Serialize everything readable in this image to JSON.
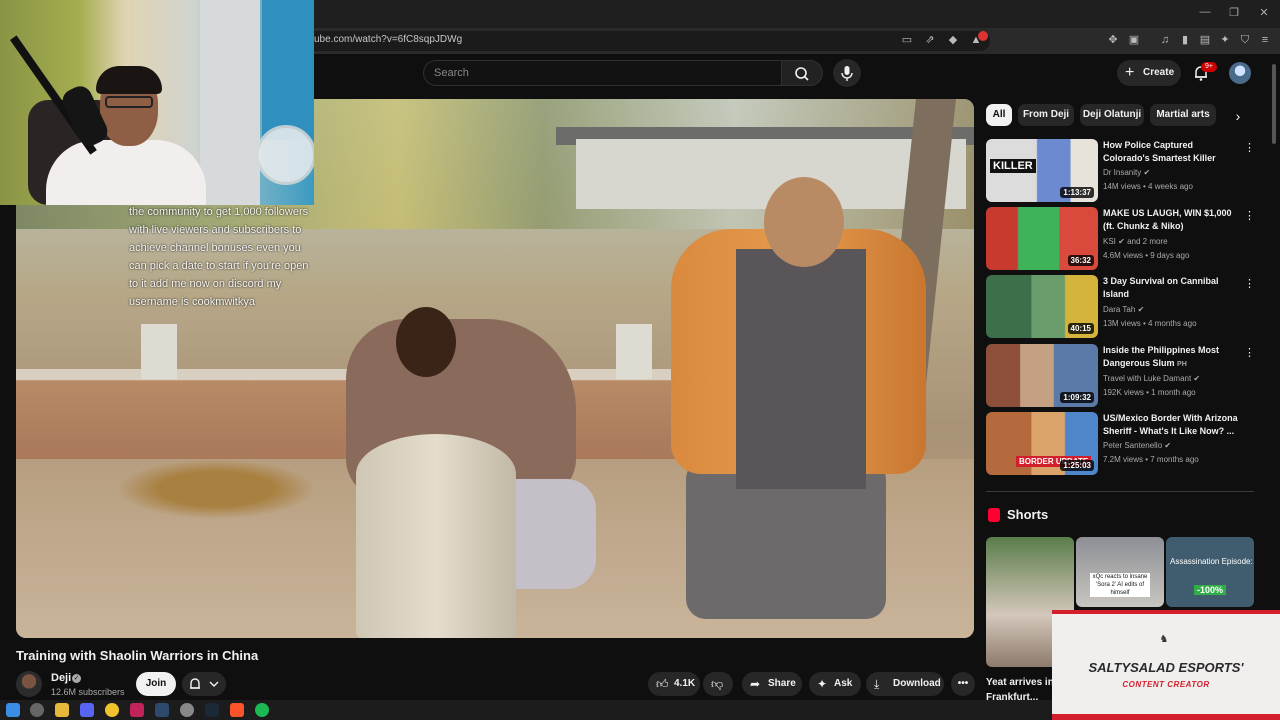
{
  "browser": {
    "url": "ube.com/watch?v=6fC8sqpJDWg",
    "notification_badge": "9+"
  },
  "masthead": {
    "search_placeholder": "Search",
    "create_label": "Create",
    "bell_badge": "9+"
  },
  "stream_overlay_text": "the community to get 1,000 followers with live viewers and subscribers to achieve channel bonuses even you can pick a date to start if you're open to it add me now on discord my username is cookmwitkya",
  "video": {
    "title": "Training with Shaolin Warriors in China",
    "channel": "Deji",
    "subscribers": "12.6M subscribers",
    "join_label": "Join",
    "likes": "4.1K",
    "share_label": "Share",
    "ask_label": "Ask",
    "download_label": "Download"
  },
  "chips": [
    "All",
    "From Deji",
    "Deji Olatunji",
    "Martial arts"
  ],
  "recommendations": [
    {
      "title": "How Police Captured Colorado's Smartest Killer",
      "channel": "Dr Insanity",
      "meta": "14M views • 4 weeks ago",
      "duration": "1:13:37",
      "thumb_text": "KILLER"
    },
    {
      "title": "MAKE US LAUGH, WIN $1,000 (ft. Chunkz & Niko)",
      "channel": "KSI",
      "channel_extra": "and 2 more",
      "meta": "4.6M views • 9 days ago",
      "duration": "36:32"
    },
    {
      "title": "3 Day Survival on Cannibal Island",
      "channel": "Dara Tah",
      "meta": "13M views • 4 months ago",
      "duration": "40:15"
    },
    {
      "title": "Inside the Philippines Most Dangerous Slum",
      "title_suffix": "PH",
      "channel": "Travel with Luke Damant",
      "meta": "192K views • 1 month ago",
      "duration": "1:09:32"
    },
    {
      "title": "US/Mexico Border With Arizona Sheriff - What's It Like Now? ...",
      "channel": "Peter Santenello",
      "meta": "7.2M views • 7 months ago",
      "duration": "1:25:03",
      "thumb_text": "BORDER UPDATE"
    }
  ],
  "shorts": {
    "section_title": "Shorts",
    "items": [
      {
        "caption": "Yeat arrives in Frankfurt..."
      },
      {
        "caption": "xQc reacts to insane 'Sora 2' AI edits of himself"
      },
      {
        "caption": "Assassination Episode:",
        "badge": "-100%"
      }
    ]
  },
  "esports": {
    "title": "SALTYSALAD ESPORTS'",
    "subtitle": "CONTENT CREATOR"
  },
  "colors": {
    "background": "#0f0f0f",
    "accent_red": "#ff0033",
    "esports_red": "#d21f2b"
  }
}
